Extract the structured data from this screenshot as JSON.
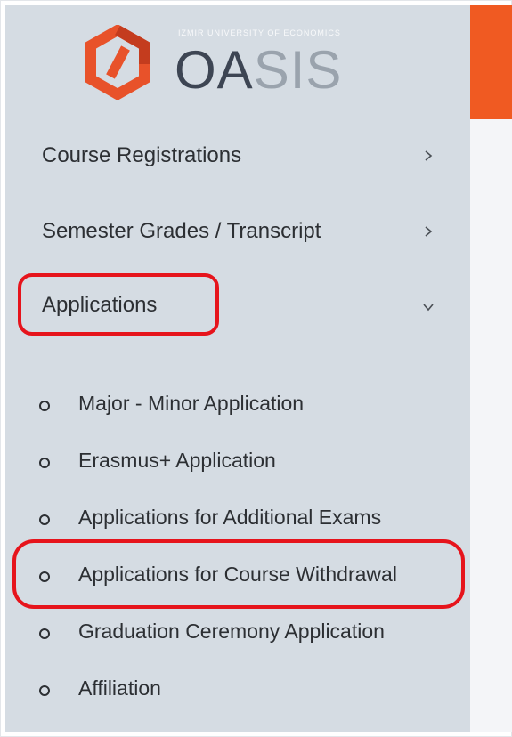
{
  "logo": {
    "brand_dark": "OA",
    "brand_light": "SIS",
    "subtitle": "IZMIR UNIVERSITY OF ECONOMICS",
    "icon": "hexagon-logo-icon"
  },
  "colors": {
    "accent": "#f05a22",
    "sidebar_bg": "#d5dce3",
    "highlight": "#e6141c",
    "text": "#2c2f33"
  },
  "menu": [
    {
      "label": "Course Registrations",
      "icon": "chevron-right-icon",
      "expanded": false
    },
    {
      "label": "Semester Grades / Transcript",
      "icon": "chevron-right-icon",
      "expanded": false
    },
    {
      "label": "Applications",
      "icon": "chevron-down-icon",
      "expanded": true
    }
  ],
  "submenu": [
    {
      "label": "Major - Minor Application"
    },
    {
      "label": "Erasmus+ Application"
    },
    {
      "label": "Applications for Additional Exams"
    },
    {
      "label": "Applications for Course Withdrawal"
    },
    {
      "label": "Graduation Ceremony Application"
    },
    {
      "label": "Affiliation"
    }
  ]
}
